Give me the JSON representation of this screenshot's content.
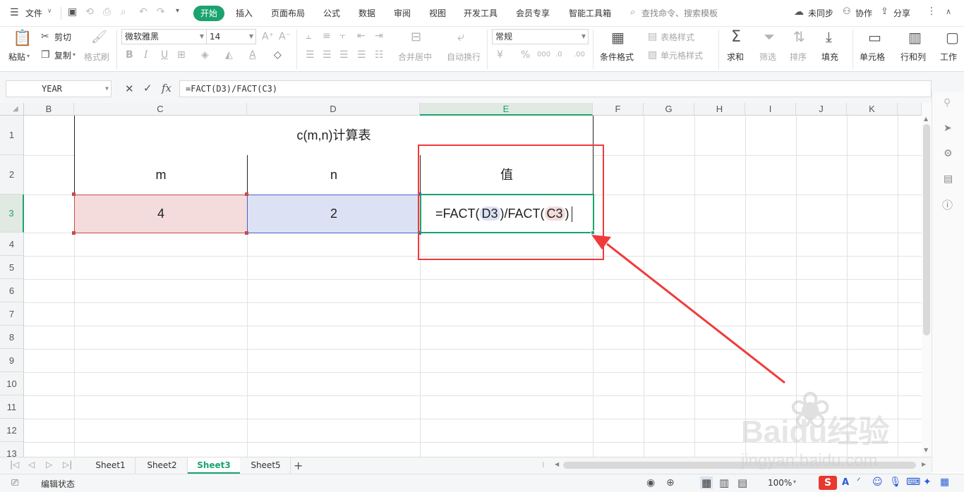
{
  "menubar": {
    "file_label": "文件",
    "tabs": [
      "开始",
      "插入",
      "页面布局",
      "公式",
      "数据",
      "审阅",
      "视图",
      "开发工具",
      "会员专享",
      "智能工具箱"
    ],
    "search_placeholder": "查找命令、搜索模板",
    "sync_label": "未同步",
    "collab_label": "协作",
    "share_label": "分享"
  },
  "ribbon": {
    "paste_label": "粘贴",
    "cut_label": "剪切",
    "copy_label": "复制",
    "format_painter_label": "格式刷",
    "font_name": "微软雅黑",
    "font_size": "14",
    "merge_center_label": "合并居中",
    "wrap_label": "自动换行",
    "number_format": "常规",
    "conditional_format_label": "条件格式",
    "table_style_label": "表格样式",
    "cell_style_label": "单元格样式",
    "sum_label": "求和",
    "filter_label": "筛选",
    "sort_label": "排序",
    "fill_label": "填充",
    "cell_label": "单元格",
    "rowcol_label": "行和列",
    "worksheet_label": "工作"
  },
  "formula_bar": {
    "name_box": "YEAR",
    "fx_label": "fx",
    "formula": "=FACT(D3)/FACT(C3)"
  },
  "grid": {
    "columns": [
      "B",
      "C",
      "D",
      "E",
      "F",
      "G",
      "H",
      "I",
      "J",
      "K"
    ],
    "rows": [
      "1",
      "2",
      "3",
      "4",
      "5",
      "6",
      "7",
      "8",
      "9",
      "10",
      "11",
      "12",
      "13"
    ],
    "title": "c(m,n)计算表",
    "header_m": "m",
    "header_n": "n",
    "header_value": "值",
    "m_value": "4",
    "n_value": "2",
    "edit_prefix": "=FACT(",
    "edit_ref1": "D3",
    "edit_mid": ")/FACT(",
    "edit_ref2": "C3",
    "edit_suffix": ")"
  },
  "sheets": [
    "Sheet1",
    "Sheet2",
    "Sheet3",
    "Sheet5"
  ],
  "active_sheet": "Sheet3",
  "statusbar": {
    "mode": "编辑状态",
    "zoom": "100%"
  },
  "watermark": {
    "brand": "Baidu经验",
    "url": "jingyan.baidu.com"
  },
  "colors": {
    "accent": "#1aa36f",
    "ref_red_fill": "#f4dcdc",
    "ref_blue_fill": "#dce2f4",
    "annotation_red": "#f03a3a"
  }
}
